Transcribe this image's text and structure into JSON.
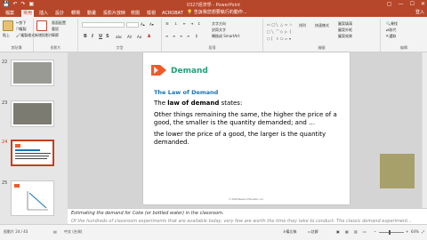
{
  "window": {
    "title": "0327經濟學 - PowerPoint",
    "controls": [
      "▢",
      "—",
      "☐",
      "✕"
    ]
  },
  "tabs": [
    "檔案",
    "常用",
    "插入",
    "設計",
    "轉場",
    "動畫",
    "投影片放映",
    "校閱",
    "檢視",
    "ACROBAT"
  ],
  "active_tab_index": 1,
  "tell_me": "告訴我您想要執行的動作...",
  "login": "登入",
  "ribbon": {
    "clipboard": {
      "paste": "貼上",
      "cut": "剪下",
      "copy": "複製",
      "format_painter": "複製格式",
      "label": "剪貼簿"
    },
    "slides": {
      "new_slide": "新增投影片",
      "layout": "版面配置",
      "reset": "重設",
      "section": "章節",
      "label": "投影片"
    },
    "font": {
      "font_name": "",
      "font_size": "",
      "bold": "B",
      "italic": "I",
      "underline": "U",
      "strike": "S",
      "label": "字型"
    },
    "paragraph": {
      "text_direction": "文字方向",
      "align_text": "對齊文字",
      "smartart": "轉換成 SmartArt",
      "label": "段落"
    },
    "drawing": {
      "arrange": "排列",
      "quick_styles": "快速樣式",
      "shape_fill": "圖案填滿",
      "shape_outline": "圖案外框",
      "shape_effects": "圖案效果",
      "label": "繪圖"
    },
    "editing": {
      "find": "尋找",
      "replace": "取代",
      "select": "選取",
      "label": "編輯"
    }
  },
  "thumbnails": [
    {
      "num": "22",
      "active": false
    },
    {
      "num": "23",
      "active": false
    },
    {
      "num": "24",
      "active": true
    },
    {
      "num": "25",
      "active": false
    }
  ],
  "slide": {
    "heading": "Demand",
    "subheading": "The Law of Demand",
    "line1_pre": "The ",
    "line1_bold": "law of demand",
    "line1_post": " states:",
    "line2": "Other things remaining the same, the higher the price of a good, the smaller is the quantity demanded; and …",
    "line3": "the lower the price of a good, the larger is the quantity demanded.",
    "footer": "© 2016 Pearson Education, Inc."
  },
  "notes": {
    "line1": "Estimating the demand for Coke (or bottled water) in the classroom.",
    "line2": "Of the hundreds of classroom experiments that are available today, very few are worth the time they take to conduct. The classic demand experiment..."
  },
  "status": {
    "slide_info": "投影片 24 / 43",
    "language": "中文 (台灣)",
    "notes": "備忘稿",
    "comments": "註解",
    "zoom": "64%"
  },
  "colors": {
    "accent": "#b7472a",
    "demand_green": "#21a07b",
    "subheading_blue": "#1b73b3",
    "logo_orange": "#f05a28",
    "olive": "#a8a06a"
  }
}
